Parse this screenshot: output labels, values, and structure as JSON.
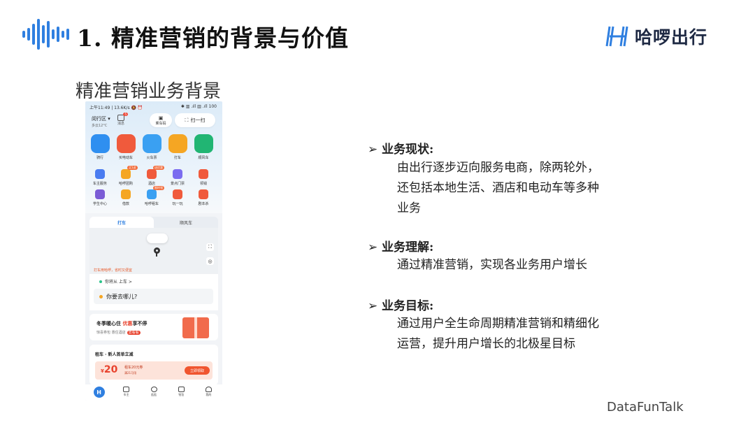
{
  "header": {
    "title": "1. 精准营销的背景与价值",
    "brand_name": "哈啰出行",
    "brand_logo_letter": "H"
  },
  "subtitle": "精准营销业务背景",
  "phone": {
    "status_time": "上午11:49 | 13.6K/s 🔕 ⏰",
    "status_right": "✱ ▥ .ıll ▥ .ıll 100",
    "city": "闵行区 ▾",
    "weather": "多云12°C",
    "message_label": "消息",
    "message_badge": "5",
    "ride_code_label": "乘车码",
    "scan_label": "扫一扫",
    "services": [
      {
        "label": "骑行",
        "color": "#2f8ff0",
        "icon": "bike-icon"
      },
      {
        "label": "买电动车",
        "color": "#f05a3c",
        "icon": "ebike-icon"
      },
      {
        "label": "火车票",
        "color": "#3aa0f2",
        "icon": "train-icon"
      },
      {
        "label": "打车",
        "color": "#f5a623",
        "icon": "taxi-icon"
      },
      {
        "label": "顺风车",
        "color": "#21b573",
        "icon": "carpool-icon"
      }
    ],
    "mini_row1": [
      {
        "label": "车主服务",
        "color": "#4a7cf0",
        "tag": ""
      },
      {
        "label": "哈啰团购",
        "color": "#f5a623",
        "tag": "买1送"
      },
      {
        "label": "酒店",
        "color": "#f05a3c",
        "tag": "送优惠"
      },
      {
        "label": "景点门票",
        "color": "#7b6cf0",
        "tag": ""
      },
      {
        "label": "领钱",
        "color": "#f05a3c",
        "tag": ""
      }
    ],
    "mini_row2": [
      {
        "label": "学生中心",
        "color": "#7b5cd6",
        "tag": ""
      },
      {
        "label": "借款",
        "color": "#f5a623",
        "tag": ""
      },
      {
        "label": "哈啰租车",
        "color": "#3aa0f2",
        "tag": "限时领"
      },
      {
        "label": "玩一玩",
        "color": "#f05a3c",
        "tag": ""
      },
      {
        "label": "剧本杀",
        "color": "#f05a3c",
        "tag": ""
      }
    ],
    "tabs": [
      "打车",
      "顺风车"
    ],
    "map_hint": "打车用哈啰，省时又便宜",
    "from_text": "你将从  上车 >",
    "destination": "你要去哪儿?",
    "promo": {
      "title_a": "冬季暖心住 ",
      "title_b": "优惠",
      "title_c": "享不停",
      "sub": "惊喜券包 惠住酒店",
      "sub_btn": "去看看"
    },
    "rent": {
      "title": "租车 · 新人首单立减",
      "currency": "¥",
      "amount": "20",
      "coupon_name": "租车20元券",
      "coupon_cond": "满21可用",
      "claim": "立即领取"
    },
    "nav": [
      "",
      "车主",
      "逛逛",
      "钱包",
      "我的"
    ]
  },
  "points": [
    {
      "heading": "业务现状:",
      "lines": [
        "由出行逐步迈向服务电商，除两轮外，",
        "还包括本地生活、酒店和电动车等多种",
        "业务"
      ]
    },
    {
      "heading": "业务理解:",
      "lines": [
        "通过精准营销，实现各业务用户增长"
      ]
    },
    {
      "heading": "业务目标:",
      "lines": [
        "通过用户全生命周期精准营销和精细化",
        "运营，提升用户增长的北极星目标"
      ]
    }
  ],
  "footer": "DataFunTalk",
  "colors": {
    "accent": "#2f7fe0",
    "promo_red": "#e8432e"
  }
}
